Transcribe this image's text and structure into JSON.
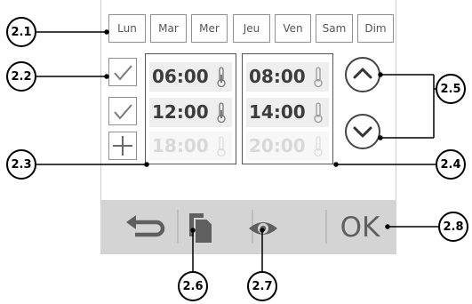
{
  "days": [
    "Lun",
    "Mar",
    "Mer",
    "Jeu",
    "Ven",
    "Sam",
    "Dim"
  ],
  "checkboxes": [
    "check",
    "check",
    "plus"
  ],
  "start_times": [
    "06:00",
    "12:00",
    "18:00"
  ],
  "end_times": [
    "08:00",
    "14:00",
    "20:00"
  ],
  "active_rows": [
    true,
    true,
    false
  ],
  "bottom_bar": {
    "ok_label": "OK",
    "icons": [
      "return-arrow-icon",
      "copy-icon",
      "eye-icon"
    ]
  },
  "callouts": {
    "c21": "2.1",
    "c22": "2.2",
    "c23": "2.3",
    "c24": "2.4",
    "c25": "2.5",
    "c26": "2.6",
    "c27": "2.7",
    "c28": "2.8"
  },
  "colors": {
    "frame": "#8f8f8f",
    "bar": "#d4d4d4",
    "icon": "#5f5f5f",
    "dim_text": "#d8d8d8"
  }
}
